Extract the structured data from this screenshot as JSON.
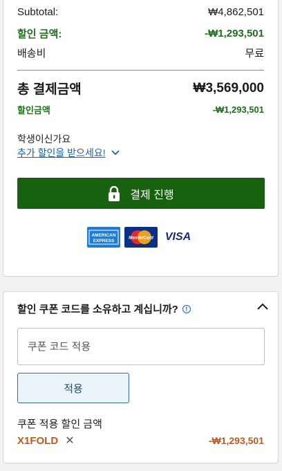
{
  "summary": {
    "subtotal_label": "Subtotal:",
    "subtotal_value": "₩4,862,501",
    "discount_label": "할인 금액:",
    "discount_value": "-₩1,293,501",
    "shipping_label": "배송비",
    "shipping_value": "무료",
    "total_label": "총 결제금액",
    "total_value": "₩3,569,000",
    "discount2_label": "할인금액",
    "discount2_value": "-₩1,293,501"
  },
  "student": {
    "question": "학생이신가요",
    "link": "추가 할인을 받으세요!"
  },
  "checkout": {
    "label": "결제 진행"
  },
  "payment_cards": [
    {
      "name": "AMERICAN EXPRESS",
      "line1": "AMERICAN",
      "line2": "EXPRESS"
    },
    {
      "name": "MasterCard"
    },
    {
      "name": "VISA"
    }
  ],
  "coupon": {
    "title": "할인 쿠폰 코드를 소유하고 계십니까?",
    "input_placeholder": "쿠폰 코드 적용",
    "apply_label": "적용",
    "applied_label": "쿠폰 적용 할인 금액",
    "code": "X1FOLD",
    "applied_value": "-₩1,293,501",
    "remove_symbol": "✕"
  },
  "colors": {
    "green": "#1f6e1f",
    "checkout_bg": "#16620f",
    "link_blue": "#1a5fb4",
    "orange": "#c4571a"
  }
}
